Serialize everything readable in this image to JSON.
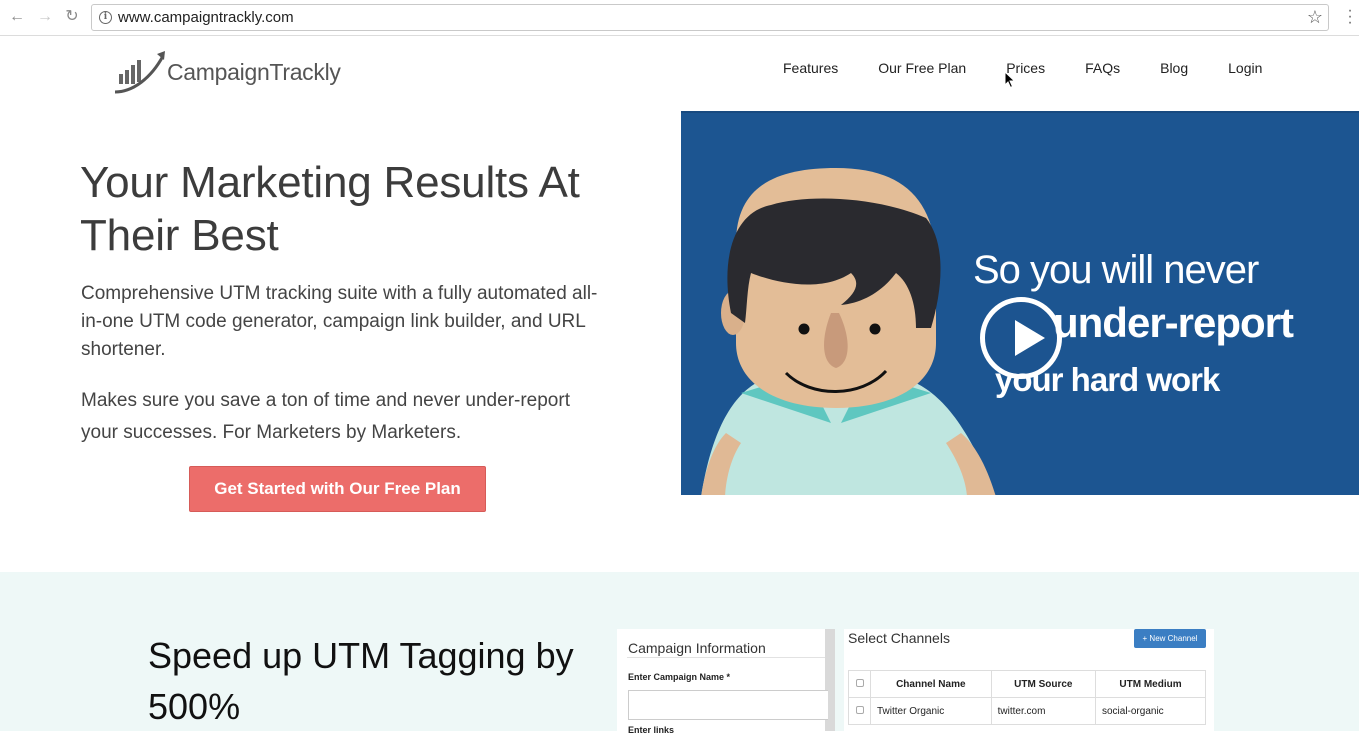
{
  "browser": {
    "url": "www.campaigntrackly.com",
    "back_icon": "arrow-left-icon",
    "forward_icon": "arrow-right-icon",
    "reload_icon": "reload-icon",
    "info_icon": "info-icon",
    "bookmark_icon": "star-icon",
    "menu_icon": "kebab-menu-icon"
  },
  "header": {
    "logo_text": "CampaignTrackly",
    "nav": [
      {
        "label": "Features"
      },
      {
        "label": "Our Free Plan"
      },
      {
        "label": "Prices"
      },
      {
        "label": "FAQs"
      },
      {
        "label": "Blog"
      },
      {
        "label": "Login"
      }
    ]
  },
  "hero": {
    "title": "Your Marketing Results At Their Best",
    "paragraph1": "Comprehensive UTM tracking suite with a fully automated all-in-one UTM code generator, campaign link builder, and URL shortener.",
    "paragraph2": "Makes sure you save a ton of time and never under-report your successes. For Marketers by Marketers.",
    "cta_label": "Get Started with Our Free Plan"
  },
  "video": {
    "line1": "So you will never",
    "line2": "under-report",
    "line3": "your hard work",
    "play_icon": "play-icon"
  },
  "features": {
    "title": "Speed up UTM Tagging by 500%",
    "campaign_panel": {
      "title": "Campaign Information",
      "name_label": "Enter Campaign Name *",
      "links_label": "Enter links"
    },
    "channels_panel": {
      "title": "Select Channels",
      "new_button": "+ New Channel",
      "columns": [
        "Channel Name",
        "UTM Source",
        "UTM Medium"
      ],
      "rows": [
        [
          "Twitter Organic",
          "twitter.com",
          "social-organic"
        ]
      ]
    }
  },
  "colors": {
    "cta": "#ec6d6a",
    "video_bg": "#1c5591",
    "band_bg": "#eef8f7",
    "button_blue": "#3b7ec3"
  }
}
